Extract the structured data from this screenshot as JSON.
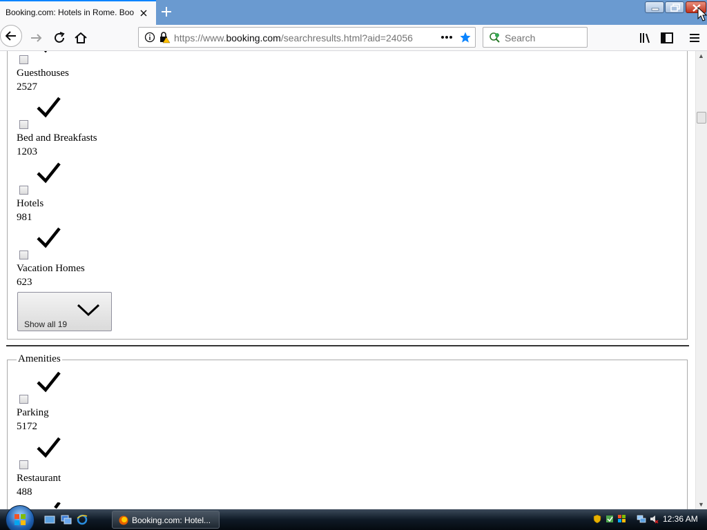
{
  "browser": {
    "tab_title": "Booking.com: Hotels in Rome. Boo",
    "url_prefix": "https://www.",
    "url_domain": "booking.com",
    "url_rest": "/searchresults.html?aid=24056",
    "search_placeholder": "Search",
    "accent_color": "#0a84ff"
  },
  "page": {
    "property_types": [
      {
        "label": "Guesthouses",
        "count": "2527"
      },
      {
        "label": "Bed and Breakfasts",
        "count": "1203"
      },
      {
        "label": "Hotels",
        "count": "981"
      },
      {
        "label": "Vacation Homes",
        "count": "623"
      }
    ],
    "show_all_label": "Show all 19",
    "amenities_legend": "Amenities",
    "amenities": [
      {
        "label": "Parking",
        "count": "5172"
      },
      {
        "label": "Restaurant",
        "count": "488"
      }
    ]
  },
  "taskbar": {
    "task_label": "Booking.com: Hotel...",
    "clock": "12:36 AM"
  }
}
